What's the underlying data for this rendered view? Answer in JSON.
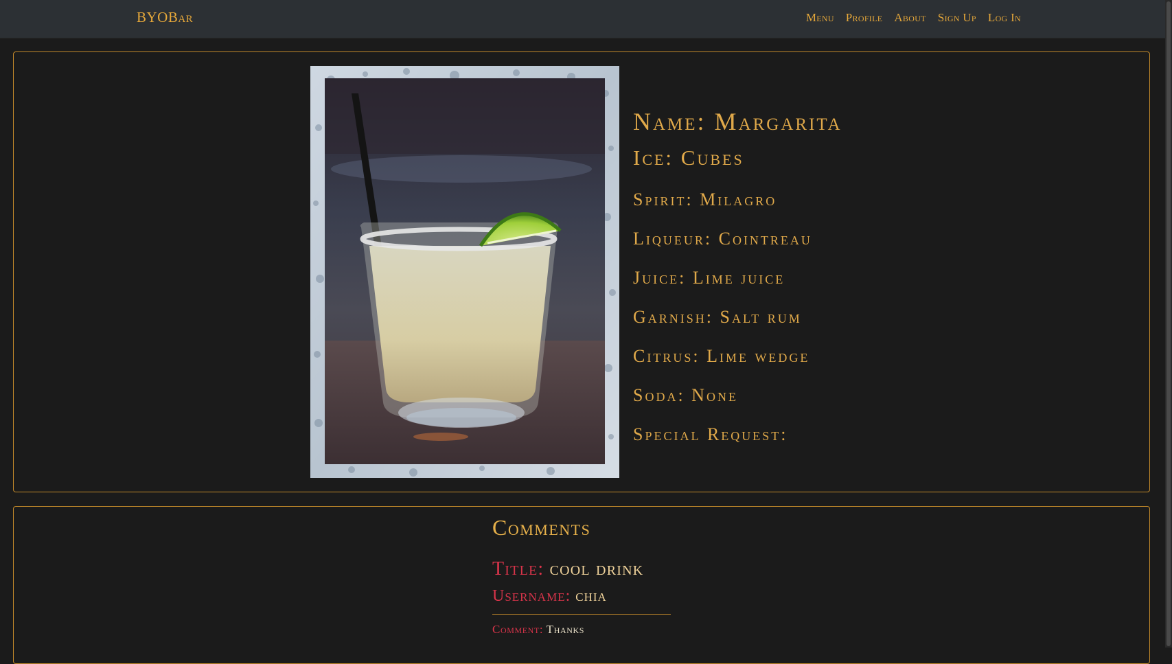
{
  "navbar": {
    "brand": "BYOBar",
    "links": [
      "Menu",
      "Profile",
      "About",
      "Sign Up",
      "Log In"
    ]
  },
  "drink": {
    "name_label": "Name: Margarita",
    "ice_label": "Ice: Cubes",
    "spirit_label": "Spirit: Milagro",
    "liqueur_label": "Liqueur: Cointreau",
    "juice_label": "Juice: Lime juice",
    "garnish_label": "Garnish: Salt rum",
    "citrus_label": "Citrus: Lime wedge",
    "soda_label": "Soda: None",
    "special_label": "Special Request:"
  },
  "comments": {
    "heading": "Comments",
    "items": [
      {
        "title_label": "Title:",
        "title_value": "cool drink",
        "username_label": "Username:",
        "username_value": "chia",
        "comment_label": "Comment:",
        "comment_value": "Thanks"
      }
    ]
  },
  "colors": {
    "accent": "#e6a83a",
    "label_red": "#d8344a",
    "card_border": "#c48a2a",
    "background": "#1b1b1b",
    "navbar": "#2c3034"
  }
}
